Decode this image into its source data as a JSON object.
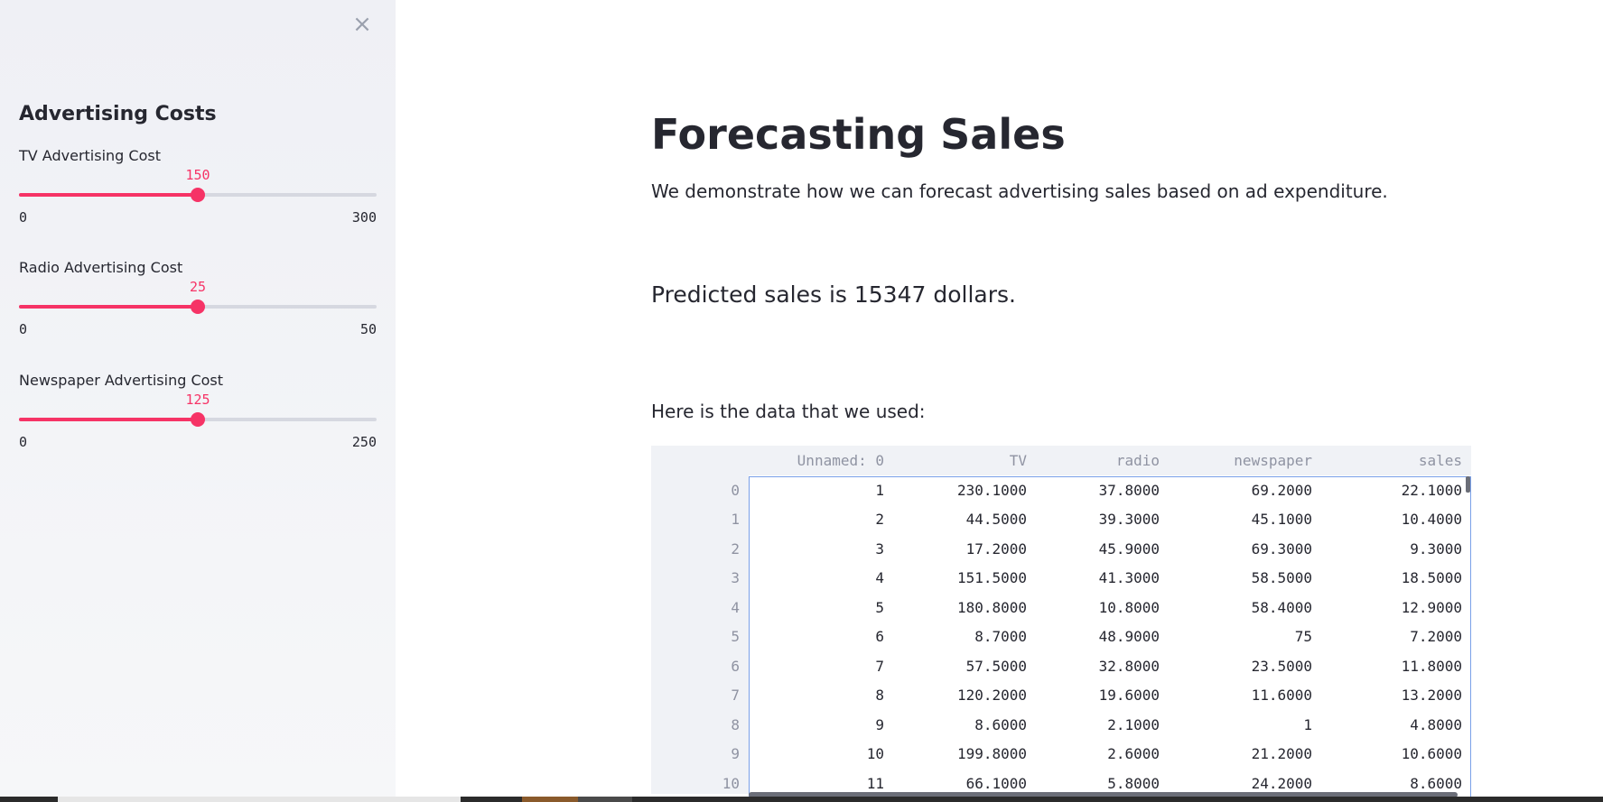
{
  "sidebar": {
    "close_icon": "×",
    "title": "Advertising Costs",
    "sliders": [
      {
        "label": "TV Advertising Cost",
        "value": "150",
        "min": "0",
        "max": "300",
        "fraction": 0.5
      },
      {
        "label": "Radio Advertising Cost",
        "value": "25",
        "min": "0",
        "max": "50",
        "fraction": 0.5
      },
      {
        "label": "Newspaper Advertising Cost",
        "value": "125",
        "min": "0",
        "max": "250",
        "fraction": 0.5
      }
    ]
  },
  "main": {
    "title": "Forecasting Sales",
    "description": "We demonstrate how we can forecast advertising sales based on ad expenditure.",
    "prediction": "Predicted sales is 15347 dollars.",
    "data_intro": "Here is the data that we used:"
  },
  "table": {
    "columns": [
      "",
      "Unnamed: 0",
      "TV",
      "radio",
      "newspaper",
      "sales"
    ],
    "rows": [
      [
        "0",
        "1",
        "230.1000",
        "37.8000",
        "69.2000",
        "22.1000"
      ],
      [
        "1",
        "2",
        "44.5000",
        "39.3000",
        "45.1000",
        "10.4000"
      ],
      [
        "2",
        "3",
        "17.2000",
        "45.9000",
        "69.3000",
        "9.3000"
      ],
      [
        "3",
        "4",
        "151.5000",
        "41.3000",
        "58.5000",
        "18.5000"
      ],
      [
        "4",
        "5",
        "180.8000",
        "10.8000",
        "58.4000",
        "12.9000"
      ],
      [
        "5",
        "6",
        "8.7000",
        "48.9000",
        "75",
        "7.2000"
      ],
      [
        "6",
        "7",
        "57.5000",
        "32.8000",
        "23.5000",
        "11.8000"
      ],
      [
        "7",
        "8",
        "120.2000",
        "19.6000",
        "11.6000",
        "13.2000"
      ],
      [
        "8",
        "9",
        "8.6000",
        "2.1000",
        "1",
        "4.8000"
      ],
      [
        "9",
        "10",
        "199.8000",
        "2.6000",
        "21.2000",
        "10.6000"
      ],
      [
        "10",
        "11",
        "66.1000",
        "5.8000",
        "24.2000",
        "8.6000"
      ]
    ]
  },
  "colors": {
    "accent": "#f63366",
    "sidebar_bg": "#f0f2f6",
    "text": "#262730",
    "muted": "#8f93a2",
    "selection_border": "#7aa0e8"
  }
}
